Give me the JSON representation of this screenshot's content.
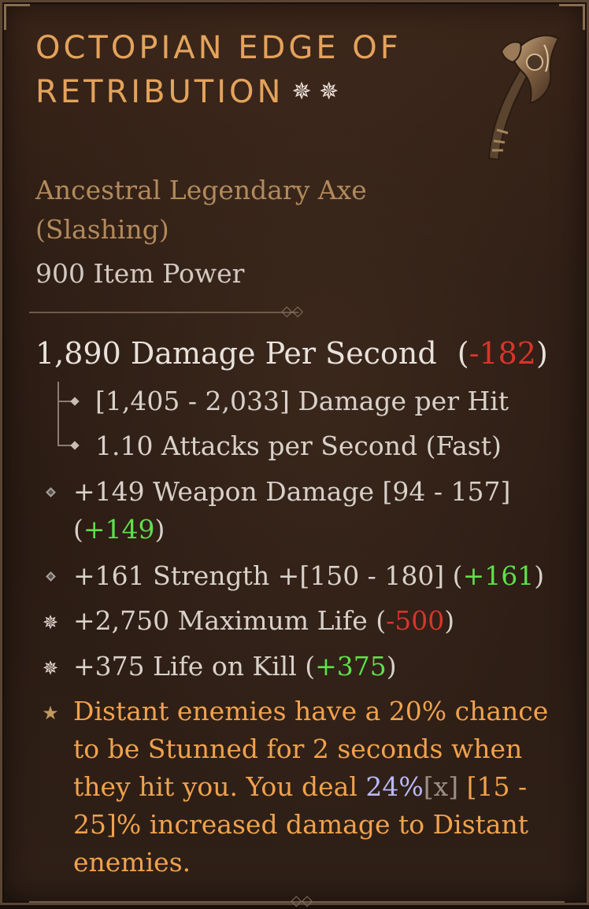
{
  "item": {
    "title": "Octopian Edge of Retribution",
    "title_marks": "✵ ✵",
    "subtype_line1": "Ancestral Legendary Axe",
    "subtype_line2": "(Slashing)",
    "item_power": "900 Item Power"
  },
  "dps": {
    "value_text": "1,890 Damage Per Second",
    "delta_open": "(",
    "delta": "-182",
    "delta_close": ")"
  },
  "sub_stats": [
    {
      "text": "[1,405 - 2,033] Damage per Hit"
    },
    {
      "text": "1.10 Attacks per Second (Fast)"
    }
  ],
  "affixes": [
    {
      "main": "+149 Weapon Damage [94 - 157] (",
      "delta": "+149",
      "close": ")",
      "bullet": "diamond"
    },
    {
      "main": "+161 Strength +[150 - 180] (",
      "delta": "+161",
      "close": ")",
      "bullet": "diamond"
    },
    {
      "main": "+2,750 Maximum Life (",
      "delta": "-500",
      "close": ")",
      "bullet": "sparkle"
    },
    {
      "main": "+375 Life on Kill (",
      "delta": "+375",
      "close": ")",
      "bullet": "sparkle"
    }
  ],
  "legendary": {
    "part1": "Distant enemies have a 20% chance to be Stunned for 2 seconds when they hit you. You deal ",
    "value": "24%",
    "mult": "[x]",
    "part2": " [15 - 25]% increased damage to Distant enemies.",
    "bullet": "star"
  },
  "colors": {
    "title": "#e3a35c",
    "subtype": "#b28a5c",
    "negative": "#d9342b",
    "positive": "#5fe04c",
    "legendary": "#f0a24e",
    "highlight": "#b9b9ff"
  }
}
